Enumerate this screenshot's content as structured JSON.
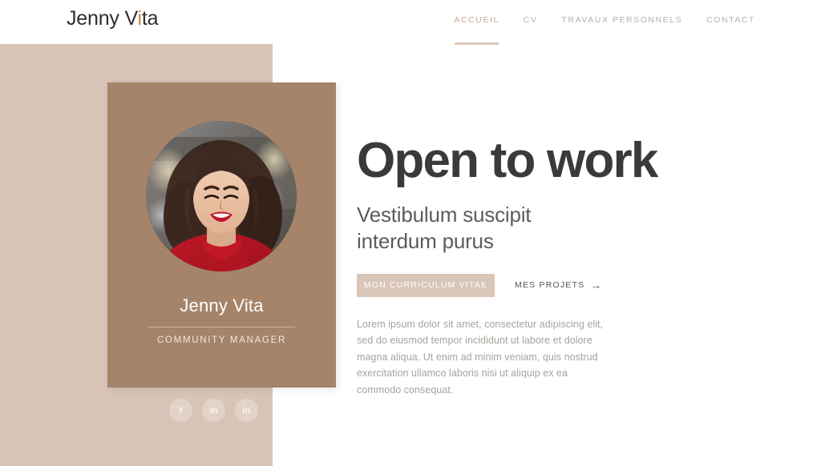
{
  "header": {
    "logo_text": "Jenny Vita",
    "nav": [
      {
        "label": "ACCUEIL",
        "active": true
      },
      {
        "label": "CV",
        "active": false
      },
      {
        "label": "TRAVAUX PERSONNELS",
        "active": false
      },
      {
        "label": "CONTACT",
        "active": false
      }
    ]
  },
  "profile_card": {
    "name": "Jenny Vita",
    "role": "COMMUNITY MANAGER",
    "photo_alt": "Portrait of a smiling woman with dark wavy hair, red lipstick and a red turtleneck"
  },
  "social": [
    {
      "icon": "facebook-icon",
      "glyph": "f"
    },
    {
      "icon": "linkedin-icon",
      "glyph": "in"
    },
    {
      "icon": "linkedin-icon",
      "glyph": "in"
    }
  ],
  "hero": {
    "headline": "Open to work",
    "subheadline": "Vestibulum suscipit interdum purus",
    "primary_button": "MON CURRICULUM VITAE",
    "secondary_link": "MES PROJETS",
    "secondary_link_arrow": "→",
    "paragraph": "Lorem ipsum dolor sit amet, consectetur adipiscing elit, sed do eiusmod tempor incididunt ut labore et dolore magna aliqua. Ut enim ad minim veniam, quis nostrud exercitation ullamco laboris nisi ut aliquip ex ea commodo consequat."
  },
  "colors": {
    "accent_beige": "#d8c4b7",
    "card_tan": "#a5846a",
    "button_tan": "#d9c6b8",
    "nav_active": "#c9a894",
    "nav_inactive": "#b6b0ab",
    "headline": "#3a3a3a",
    "logo_dot": "#c98a4b"
  }
}
